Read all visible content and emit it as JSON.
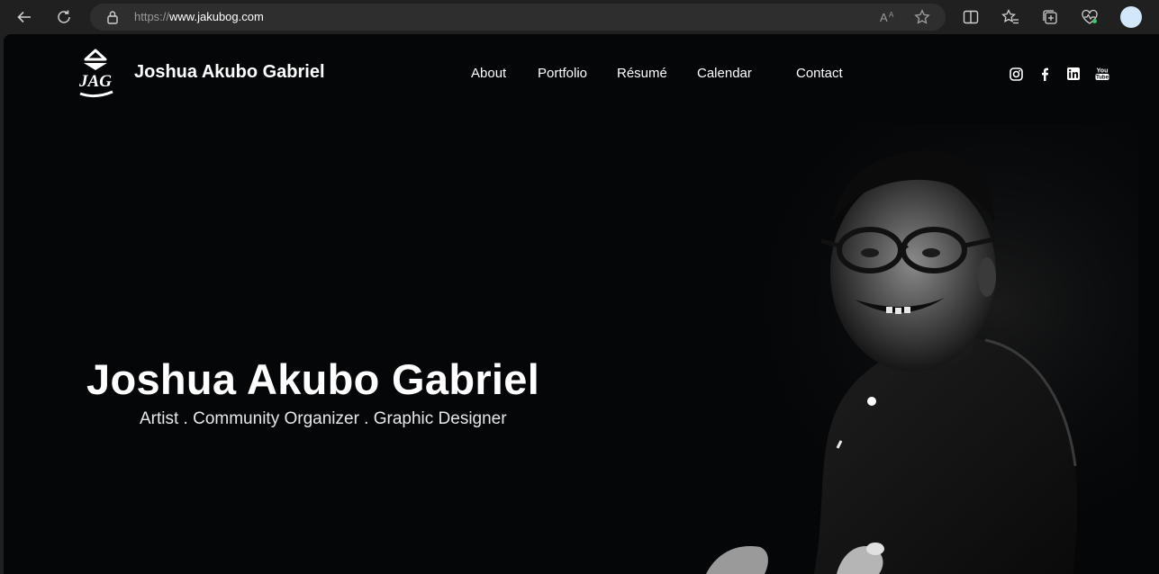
{
  "browser": {
    "url_scheme": "https://",
    "url_host": "www.jakubog.com"
  },
  "site": {
    "name": "Joshua Akubo Gabriel",
    "logo_text": "JAG"
  },
  "nav": {
    "about": "About",
    "portfolio": "Portfolio",
    "resume": "Résumé",
    "calendar": "Calendar",
    "contact": "Contact"
  },
  "social": [
    "instagram-icon",
    "facebook-icon",
    "linkedin-icon",
    "youtube-icon"
  ],
  "hero": {
    "title": "Joshua Akubo Gabriel",
    "subtitle": "Artist . Community Organizer . Graphic Designer"
  },
  "colors": {
    "page_bg": "#040608",
    "chrome_bg": "#202020",
    "text": "#ffffff"
  }
}
